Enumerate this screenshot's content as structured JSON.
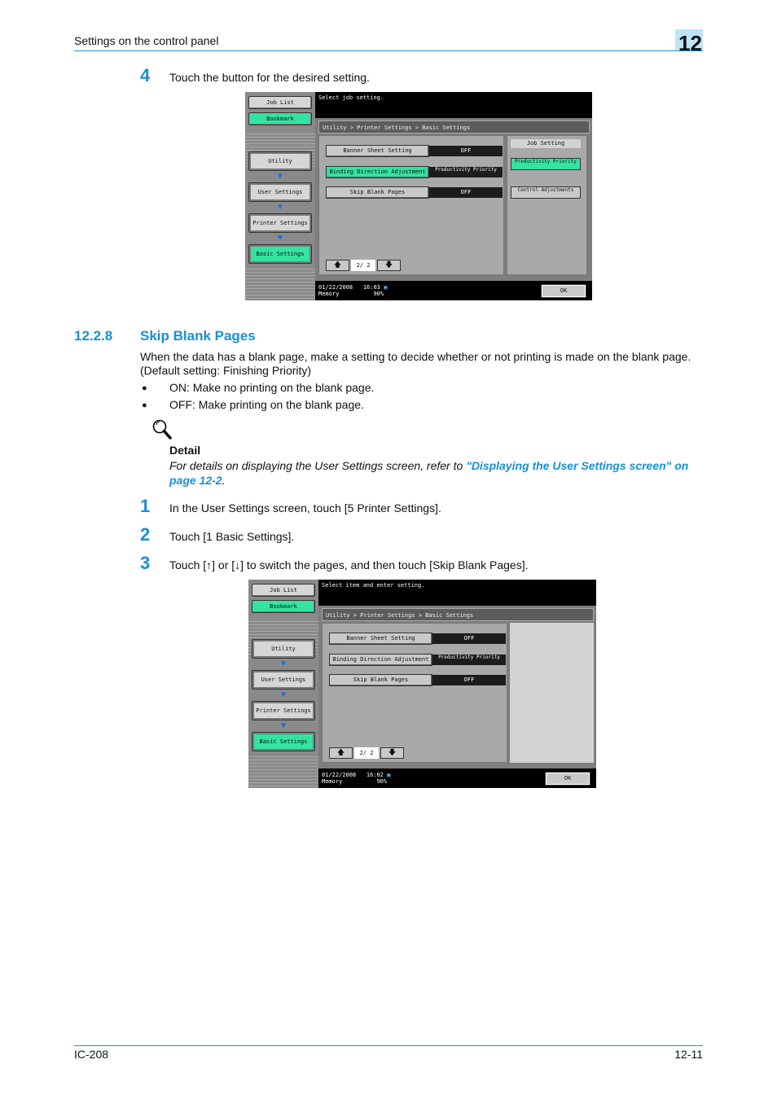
{
  "header": {
    "title": "Settings on the control panel",
    "chapter": "12"
  },
  "footer": {
    "left": "IC-208",
    "right": "12-11"
  },
  "step_top": {
    "number": "4",
    "text": "Touch the button for the desired setting."
  },
  "section": {
    "number": "12.2.8",
    "title": "Skip Blank Pages",
    "para1": "When the data has a blank page, make a setting to decide whether or not printing is made on the blank page.",
    "para2": "(Default setting: Finishing Priority)",
    "bullets": [
      "ON: Make no printing on the blank page.",
      "OFF: Make printing on the blank page."
    ],
    "bullet_char": "●"
  },
  "detail": {
    "title": "Detail",
    "text_before": "For details on displaying the User Settings screen, refer to ",
    "link_text": "\"Displaying the User Settings screen\" on page 12-2",
    "text_after": "."
  },
  "steps": [
    {
      "number": "1",
      "text": "In the User Settings screen, touch [5 Printer Settings]."
    },
    {
      "number": "2",
      "text": "Touch [1 Basic Settings]."
    },
    {
      "number": "3",
      "text": "Touch [↑] or [↓] to switch the pages, and then touch [Skip Blank Pages]."
    }
  ],
  "screen1": {
    "message": "Select job setting.",
    "job_list": "Job List",
    "bookmark": "Bookmark",
    "nav": [
      "Utility",
      "User Settings",
      "Printer Settings",
      "Basic Settings"
    ],
    "breadcrumb": "Utility > Printer Settings > Basic Settings",
    "rows": [
      {
        "label": "Banner Sheet Setting",
        "value": "OFF"
      },
      {
        "label": "Binding Direction Adjustment",
        "value": "Productivity Priority"
      },
      {
        "label": "Skip Blank Pages",
        "value": "OFF"
      }
    ],
    "page": "2/ 2",
    "job_setting_title": "Job Setting",
    "job_setting_buttons": [
      "Productivity Priority",
      "Control Adjustments"
    ],
    "date": "01/22/2008",
    "time": "16:03",
    "memory_label": "Memory",
    "memory_value": "90%",
    "ok": "OK"
  },
  "screen2": {
    "message": "Select item and enter setting.",
    "job_list": "Job List",
    "bookmark": "Bookmark",
    "nav": [
      "Utility",
      "User Settings",
      "Printer Settings",
      "Basic Settings"
    ],
    "breadcrumb": "Utility > Printer Settings > Basic Settings",
    "rows": [
      {
        "label": "Banner Sheet Setting",
        "value": "OFF"
      },
      {
        "label": "Binding Direction Adjustment",
        "value": "Productivity Priority"
      },
      {
        "label": "Skip Blank Pages",
        "value": "OFF"
      }
    ],
    "page": "2/ 2",
    "date": "01/22/2008",
    "time": "16:02",
    "memory_label": "Memory",
    "memory_value": "90%",
    "ok": "OK"
  }
}
